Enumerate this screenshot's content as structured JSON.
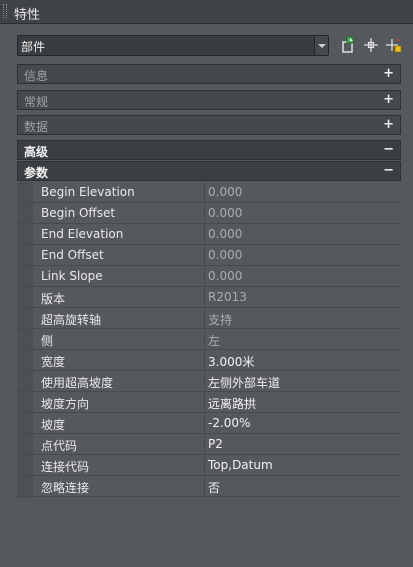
{
  "panel": {
    "title": "特性"
  },
  "selector": {
    "value": "部件"
  },
  "toolbar": {
    "buttons": [
      {
        "icon": "select-objects-icon"
      },
      {
        "icon": "pick-point-icon"
      },
      {
        "icon": "quick-select-icon"
      }
    ]
  },
  "sections": [
    {
      "label": "信息",
      "toggle": "+"
    },
    {
      "label": "常规",
      "toggle": "+"
    },
    {
      "label": "数据",
      "toggle": "+"
    },
    {
      "label": "高级",
      "toggle": "−"
    },
    {
      "label": "参数",
      "toggle": "−"
    }
  ],
  "properties": [
    {
      "name": "Begin Elevation",
      "value": "0.000",
      "disabled": true
    },
    {
      "name": "Begin Offset",
      "value": "0.000",
      "disabled": true
    },
    {
      "name": "End Elevation",
      "value": "0.000",
      "disabled": true
    },
    {
      "name": "End Offset",
      "value": "0.000",
      "disabled": true
    },
    {
      "name": "Link Slope",
      "value": "0.000",
      "disabled": true
    },
    {
      "name": "版本",
      "value": "R2013",
      "disabled": true
    },
    {
      "name": "超高旋转轴",
      "value": "支持",
      "disabled": true
    },
    {
      "name": "侧",
      "value": "左",
      "disabled": true
    },
    {
      "name": "宽度",
      "value": "3.000米",
      "disabled": false
    },
    {
      "name": "使用超高坡度",
      "value": "左侧外部车道",
      "disabled": false
    },
    {
      "name": "坡度方向",
      "value": "远离路拱",
      "disabled": false
    },
    {
      "name": "坡度",
      "value": "-2.00%",
      "disabled": false
    },
    {
      "name": "点代码",
      "value": "P2",
      "disabled": false
    },
    {
      "name": "连接代码",
      "value": "Top,Datum",
      "disabled": false
    },
    {
      "name": "忽略连接",
      "value": "否",
      "disabled": false
    }
  ]
}
